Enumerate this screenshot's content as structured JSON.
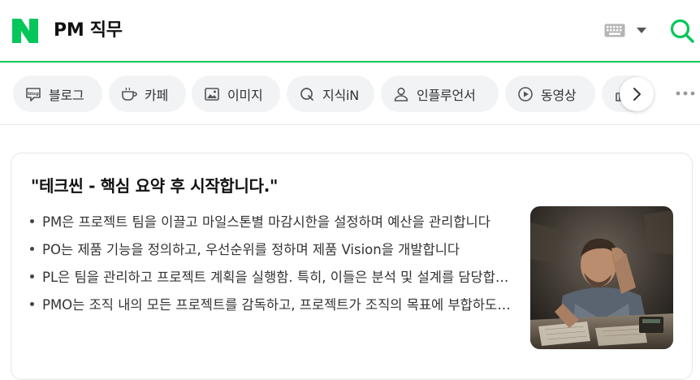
{
  "search": {
    "query": "PM 직무"
  },
  "tabs": [
    {
      "label": "블로그",
      "icon": "blog-icon"
    },
    {
      "label": "카페",
      "icon": "cafe-cup-icon"
    },
    {
      "label": "이미지",
      "icon": "image-icon"
    },
    {
      "label": "지식iN",
      "icon": "knowledge-in-icon"
    },
    {
      "label": "인플루언서",
      "icon": "person-icon"
    },
    {
      "label": "동영상",
      "icon": "play-icon"
    }
  ],
  "card": {
    "title": "\"테크씬 - 핵심 요약 후 시작합니다.\"",
    "bullets": [
      "PM은 프로젝트 팀을 이끌고 마일스톤별 마감시한을 설정하며 예산을 관리합니다",
      "PO는 제품 기능을 정의하고, 우선순위를 정하며 제품 Vision을 개발합니다",
      "PL은 팀을 관리하고 프로젝트 계획을 실행함. 특히, 이들은 분석 및 설계를 담당합니다",
      "PMO는 조직 내의 모든 프로젝트를 감독하고, 프로젝트가 조직의 목표에 부합하도록 합니다"
    ]
  },
  "colors": {
    "brand_green": "#03c75a",
    "chip_bg": "#f2f3f5"
  }
}
